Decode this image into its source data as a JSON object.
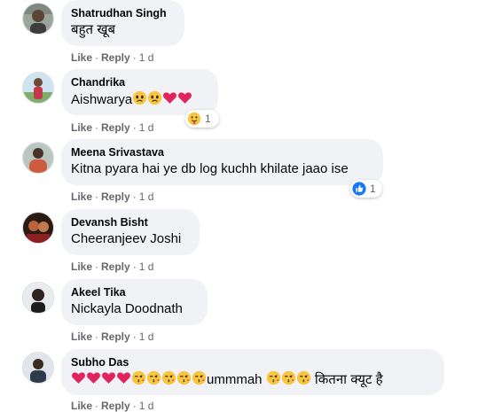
{
  "comments": [
    {
      "name": "Shatrudhan Singh",
      "text": "बहुत खूब",
      "like": "Like",
      "reply": "Reply",
      "time": "1 d"
    },
    {
      "name": "Chandrika",
      "text": "Aishwarya",
      "like": "Like",
      "reply": "Reply",
      "time": "1 d",
      "reaction_count": "1",
      "reaction_icon": "care-emoji-icon"
    },
    {
      "name": "Meena Srivastava",
      "text": "Kitna pyara hai ye db log kuchh khilate jaao ise",
      "like": "Like",
      "reply": "Reply",
      "time": "1 d",
      "reaction_count": "1",
      "reaction_icon": "like-thumb-icon"
    },
    {
      "name": "Devansh Bisht",
      "text": "Cheeranjeev Joshi",
      "like": "Like",
      "reply": "Reply",
      "time": "1 d"
    },
    {
      "name": "Akeel Tika",
      "text": "Nickayla Doodnath",
      "like": "Like",
      "reply": "Reply",
      "time": "1 d"
    },
    {
      "name": "Subho Das",
      "text_mid": "ummmah",
      "text_end": "कितना क्यूट है",
      "like": "Like",
      "reply": "Reply",
      "time": "1 d"
    }
  ],
  "colors": {
    "bubble": "#f0f2f5",
    "meta": "#65676b",
    "text": "#050505",
    "like_blue": "#1877f2",
    "heart": "#e0245e",
    "emoji_yellow": "#f7c53f"
  }
}
